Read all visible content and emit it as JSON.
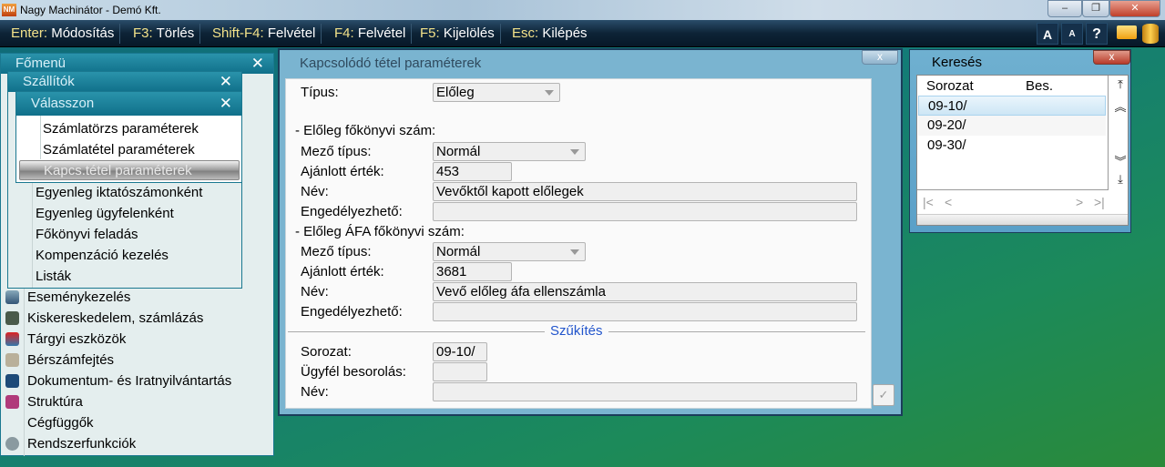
{
  "window": {
    "title": "Nagy Machinátor - Demó Kft.",
    "logo": "NM",
    "controls": {
      "minimize": "‒",
      "restore": "❐",
      "close": "✕"
    }
  },
  "toolbar": {
    "items": [
      {
        "key": "Enter:",
        "label": "Módosítás"
      },
      {
        "key": "F3:",
        "label": "Törlés"
      },
      {
        "key": "Shift-F4:",
        "label": "Felvétel"
      },
      {
        "key": "F4:",
        "label": "Felvétel"
      },
      {
        "key": "F5:",
        "label": "Kijelölés"
      },
      {
        "key": "Esc:",
        "label": "Kilépés"
      }
    ],
    "font_larger": "A",
    "font_smaller": "A",
    "help": "?"
  },
  "main_menu": {
    "title": "Főmenü",
    "close": "✕",
    "items": [
      "Eseménykezelés",
      "Kiskereskedelem, számlázás",
      "Tárgyi eszközök",
      "Bérszámfejtés",
      "Dokumentum- és Iratnyilvántartás",
      "Struktúra",
      "Cégfüggők",
      "Rendszerfunkciók"
    ]
  },
  "suppliers_menu": {
    "title": "Szállítók",
    "close": "✕",
    "items": [
      "Egyenleg iktatószámonként",
      "Egyenleg ügyfelenként",
      "Főkönyvi feladás",
      "Kompenzáció kezelés",
      "Listák"
    ]
  },
  "choose_menu": {
    "title": "Válasszon",
    "close": "✕",
    "items": [
      "Számlatörzs paraméterek",
      "Számlatétel paraméterek",
      "Kapcs.tétel paraméterek"
    ]
  },
  "dialog": {
    "title": "Kapcsolódó tétel paraméterek",
    "close": "x",
    "type_label": "Típus:",
    "type_value": "Előleg",
    "section1": "- Előleg főkönyvi szám:",
    "s1": {
      "field_type_label": "Mező típus:",
      "field_type": "Normál",
      "default_label": "Ajánlott érték:",
      "default": "453",
      "name_label": "Név:",
      "name": "Vevőktől kapott előlegek",
      "allow_label": "Engedélyezhető:",
      "allow": ""
    },
    "section2": "- Előleg ÁFA főkönyvi szám:",
    "s2": {
      "field_type_label": "Mező típus:",
      "field_type": "Normál",
      "default_label": "Ajánlott érték:",
      "default": "3681",
      "name_label": "Név:",
      "name": "Vevő előleg áfa ellenszámla",
      "allow_label": "Engedélyezhető:",
      "allow": ""
    },
    "filter_title": "Szűkítés",
    "filter": {
      "series_label": "Sorozat:",
      "series": "09-10/",
      "client_label": "Ügyfél besorolás:",
      "client": "",
      "name_label": "Név:",
      "name": ""
    },
    "ok": "✓"
  },
  "search": {
    "title": "Keresés",
    "close": "x",
    "columns": [
      "Sorozat",
      "Bes."
    ],
    "rows": [
      "09-10/",
      "09-20/",
      "09-30/"
    ],
    "nav": {
      "first": "|<",
      "prev": "<",
      "next": ">",
      "last": ">|"
    }
  },
  "colors": {
    "accent_key": "#f3e28a",
    "filter_title": "#2255cc"
  }
}
